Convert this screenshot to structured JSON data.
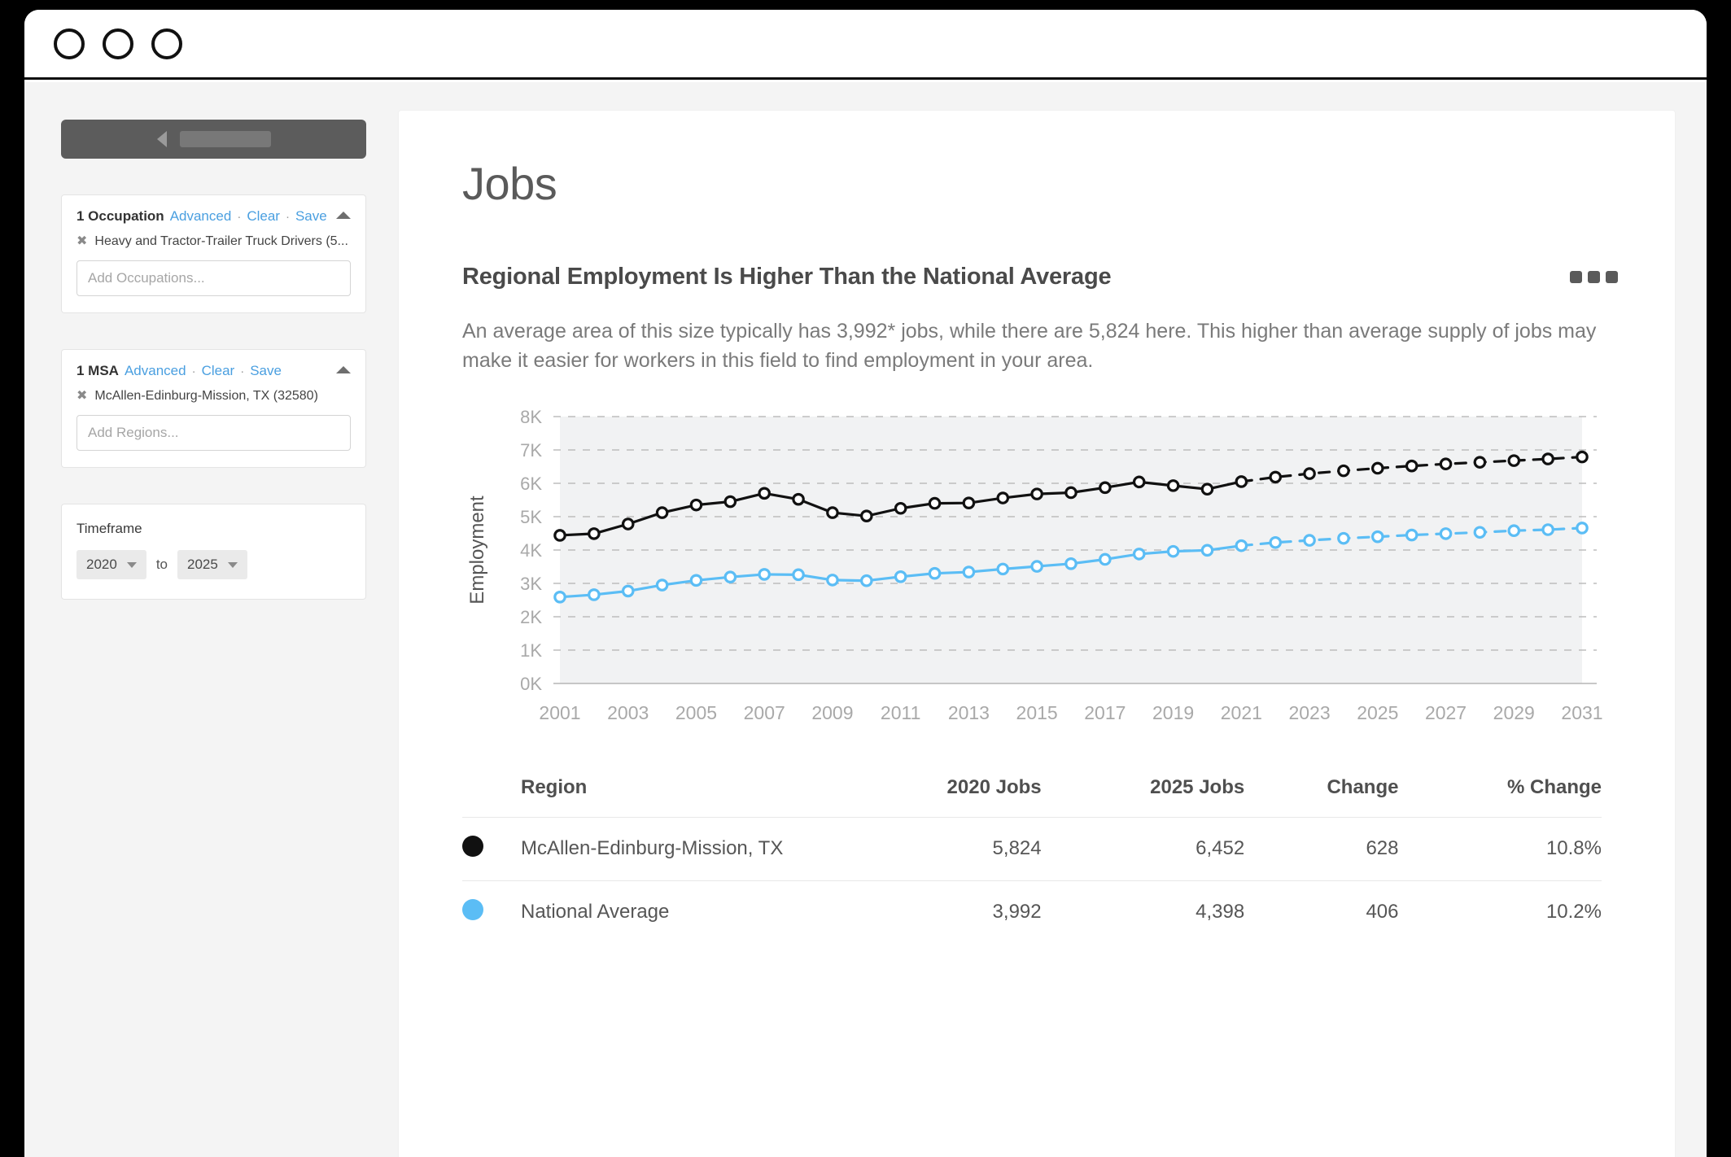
{
  "window": {
    "dots": [
      "window-dot-1",
      "window-dot-2",
      "window-dot-3"
    ]
  },
  "sidebar": {
    "collapse_bar": {
      "arrow_icon": "chevron-left-icon",
      "redacted_label": ""
    },
    "filters": [
      {
        "count_label": "1 Occupation",
        "advanced_label": "Advanced",
        "clear_label": "Clear",
        "save_label": "Save",
        "separator": "·",
        "chip_remove_icon": "✖",
        "chip_label": "Heavy and Tractor-Trailer Truck Drivers (5...",
        "input_placeholder": "Add Occupations...",
        "input_value": ""
      },
      {
        "count_label": "1 MSA",
        "advanced_label": "Advanced",
        "clear_label": "Clear",
        "save_label": "Save",
        "separator": "·",
        "chip_remove_icon": "✖",
        "chip_label": "McAllen-Edinburg-Mission, TX (32580)",
        "input_placeholder": "Add Regions...",
        "input_value": ""
      }
    ],
    "timeframe": {
      "label": "Timeframe",
      "start_value": "2020",
      "to_label": "to",
      "end_value": "2025"
    }
  },
  "main": {
    "page_title": "Jobs",
    "section_title": "Regional Employment Is Higher Than the National Average",
    "kebab_label": "•••",
    "description": "An average area of this size typically has 3,992* jobs, while there are 5,824 here. This higher than average supply of jobs may make it easier for workers in this field to find employment in your area."
  },
  "colors": {
    "regional": "#111111",
    "national": "#5BBDF5",
    "link": "#4a9fe0",
    "gridline": "#bdbdbd",
    "band": "#f1f2f3"
  },
  "chart_data": {
    "type": "line",
    "title": "",
    "xlabel": "",
    "ylabel": "Employment",
    "ylim": [
      0,
      8000
    ],
    "ytick_labels": [
      "0K",
      "1K",
      "2K",
      "3K",
      "4K",
      "5K",
      "6K",
      "7K",
      "8K"
    ],
    "ytick_values": [
      0,
      1000,
      2000,
      3000,
      4000,
      5000,
      6000,
      7000,
      8000
    ],
    "grid": true,
    "legend_position": "table-below",
    "x": [
      2001,
      2002,
      2003,
      2004,
      2005,
      2006,
      2007,
      2008,
      2009,
      2010,
      2011,
      2012,
      2013,
      2014,
      2015,
      2016,
      2017,
      2018,
      2019,
      2020,
      2021,
      2022,
      2023,
      2024,
      2025,
      2026,
      2027,
      2028,
      2029,
      2030,
      2031
    ],
    "xtick_labels": [
      "2001",
      "2003",
      "2005",
      "2007",
      "2009",
      "2011",
      "2013",
      "2015",
      "2017",
      "2019",
      "2021",
      "2023",
      "2025",
      "2027",
      "2029",
      "2031"
    ],
    "forecast_start": 2021,
    "series": [
      {
        "name": "McAllen-Edinburg-Mission, TX",
        "color": "#111111",
        "values": [
          4440,
          4490,
          4780,
          5120,
          5350,
          5450,
          5700,
          5520,
          5120,
          5020,
          5250,
          5400,
          5410,
          5560,
          5680,
          5720,
          5870,
          6040,
          5930,
          5824,
          6050,
          6185,
          6290,
          6375,
          6452,
          6520,
          6580,
          6630,
          6680,
          6730,
          6790
        ]
      },
      {
        "name": "National Average",
        "color": "#5BBDF5",
        "values": [
          2590,
          2660,
          2770,
          2950,
          3090,
          3190,
          3270,
          3260,
          3100,
          3080,
          3200,
          3300,
          3340,
          3430,
          3510,
          3590,
          3720,
          3880,
          3960,
          3992,
          4130,
          4225,
          4290,
          4350,
          4398,
          4450,
          4490,
          4530,
          4580,
          4610,
          4660
        ]
      }
    ]
  },
  "table": {
    "columns": [
      "",
      "Region",
      "2020 Jobs",
      "2025 Jobs",
      "Change",
      "% Change"
    ],
    "rows": [
      {
        "swatch_color": "#111111",
        "region": "McAllen-Edinburg-Mission, TX",
        "jobs_2020": "5,824",
        "jobs_2025": "6,452",
        "change": "628",
        "pct_change": "10.8%"
      },
      {
        "swatch_color": "#5BBDF5",
        "region": "National Average",
        "jobs_2020": "3,992",
        "jobs_2025": "4,398",
        "change": "406",
        "pct_change": "10.2%"
      }
    ]
  }
}
